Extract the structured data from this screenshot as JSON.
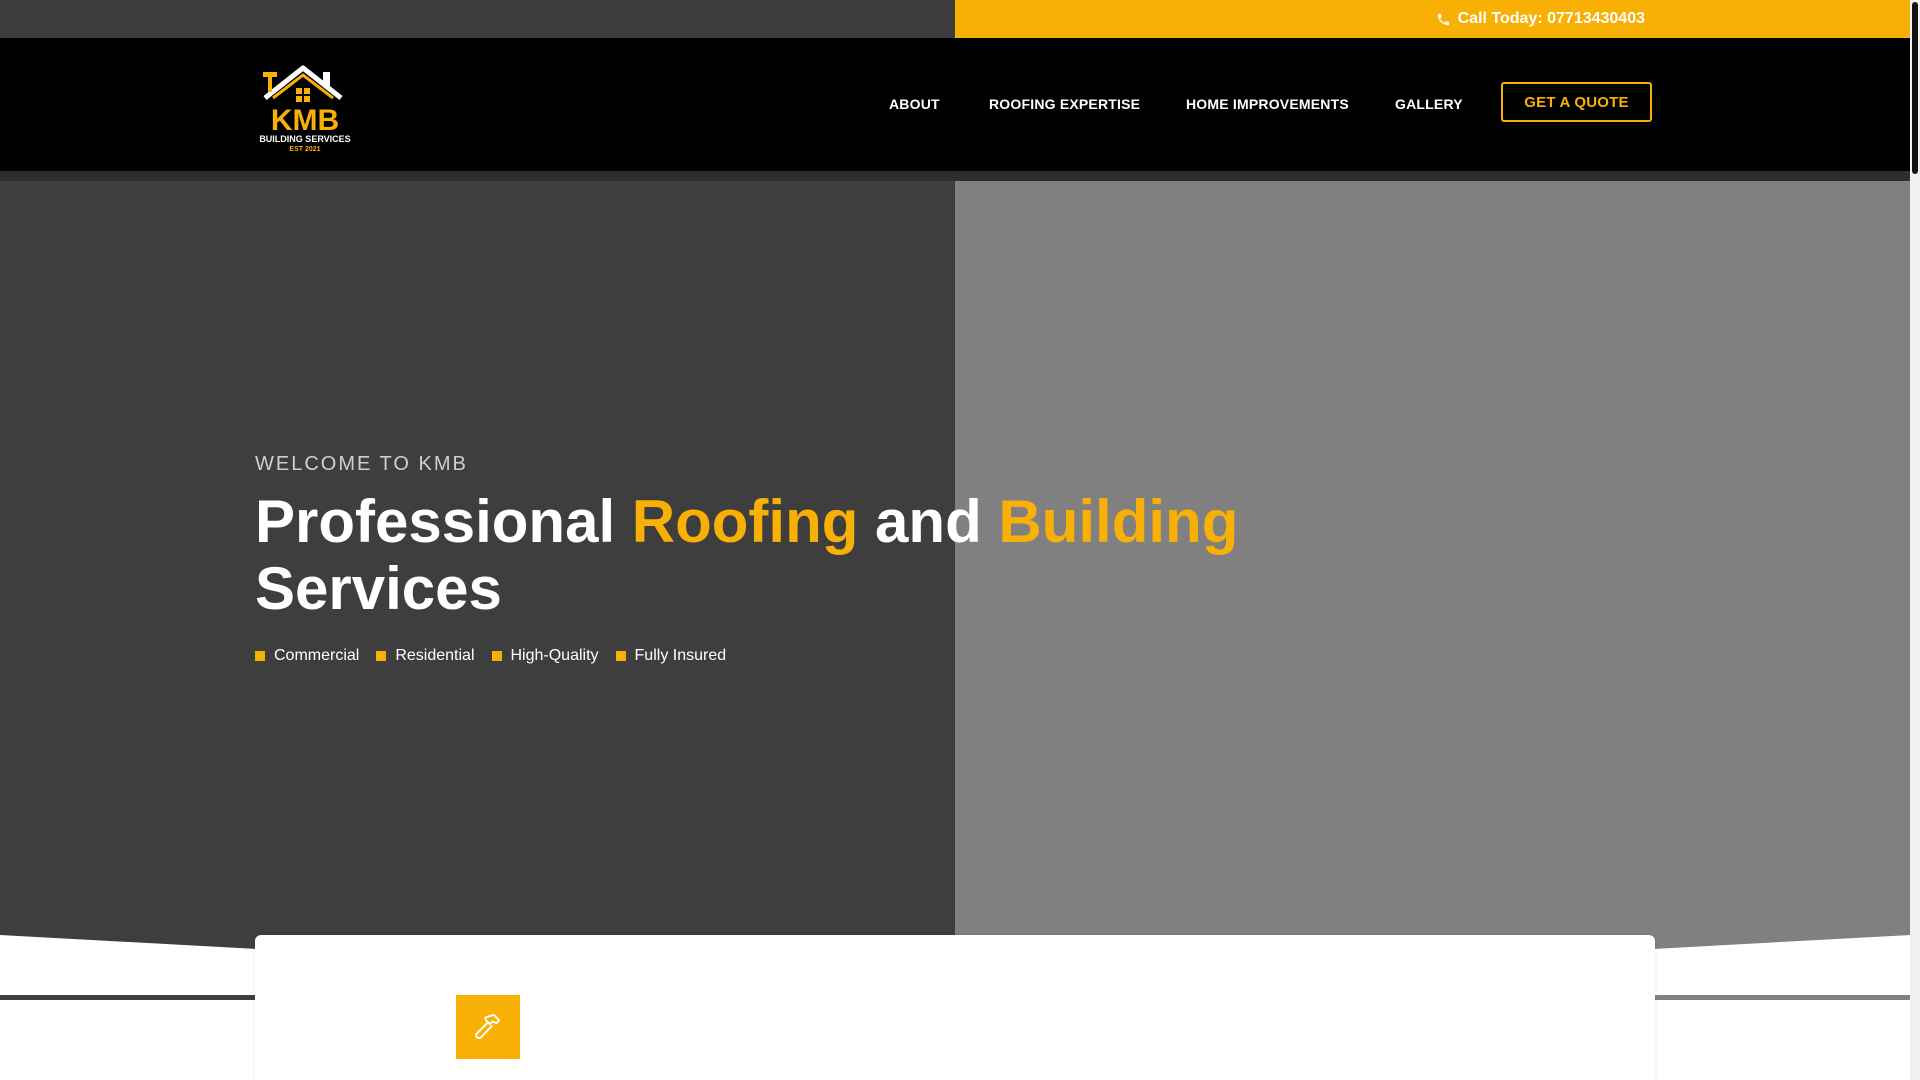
{
  "topbar": {
    "call_text": "Call Today: 07713430403",
    "icon": "phone-icon"
  },
  "header": {
    "logo": {
      "text_main": "KMB",
      "text_sub": "BUILDING SERVICES",
      "text_est": "EST 2021"
    },
    "nav": [
      {
        "label": "ABOUT"
      },
      {
        "label": "ROOFING EXPERTISE"
      },
      {
        "label": "HOME IMPROVEMENTS"
      },
      {
        "label": "GALLERY"
      }
    ],
    "cta_label": "GET A QUOTE"
  },
  "hero": {
    "eyebrow": "WELCOME TO KMB",
    "headline": {
      "part1": "Professional ",
      "highlight1": "Roofing",
      "part2": " and ",
      "highlight2": "Building",
      "part3": "Services"
    },
    "features": [
      "Commercial",
      "Residential",
      "High-Quality",
      "Fully Insured"
    ]
  },
  "service": {
    "icon": "hammer-icon"
  },
  "colors": {
    "accent": "#f8b005",
    "dark": "#000000",
    "topbar_dark": "#3c3c3c",
    "hero_left": "#3e3e3e",
    "hero_right": "#808080"
  }
}
